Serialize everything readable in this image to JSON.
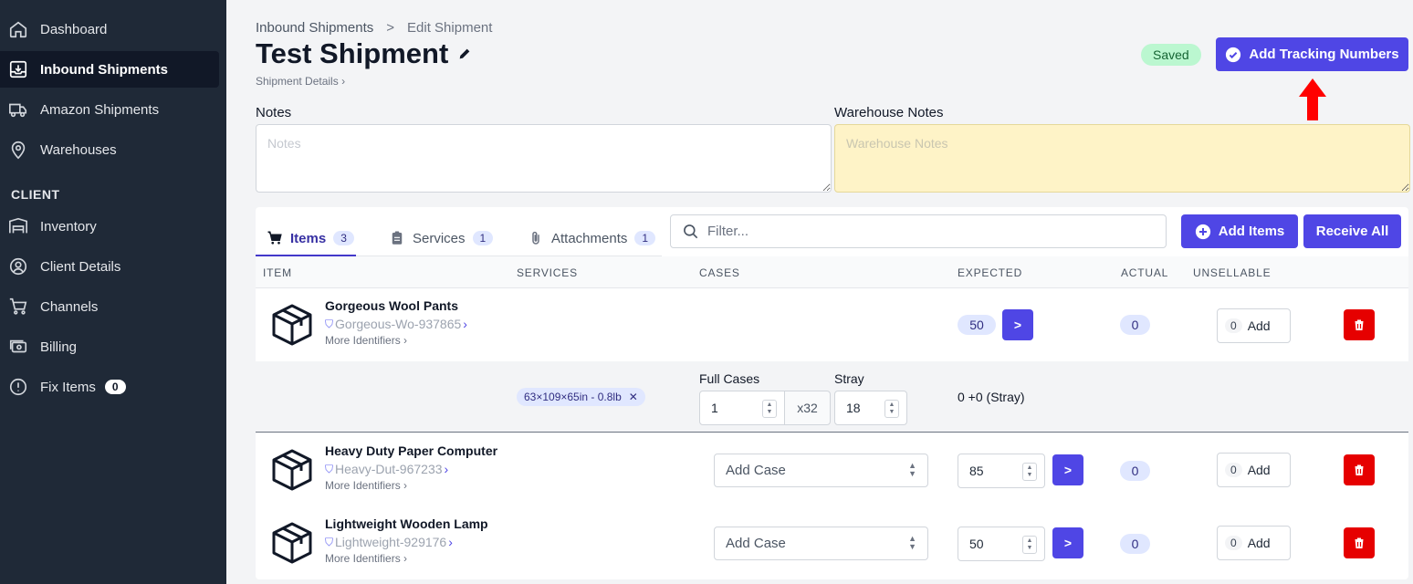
{
  "sidebar": {
    "items": [
      {
        "label": "Dashboard",
        "icon": "home-icon"
      },
      {
        "label": "Inbound Shipments",
        "icon": "inbox-download-icon"
      },
      {
        "label": "Amazon Shipments",
        "icon": "truck-icon"
      },
      {
        "label": "Warehouses",
        "icon": "location-pin-icon"
      }
    ],
    "section_label": "CLIENT",
    "client_items": [
      {
        "label": "Inventory",
        "icon": "shelves-icon"
      },
      {
        "label": "Client Details",
        "icon": "user-circle-icon"
      },
      {
        "label": "Channels",
        "icon": "cart-icon"
      },
      {
        "label": "Billing",
        "icon": "cash-icon"
      },
      {
        "label": "Fix Items",
        "icon": "alert-circle-icon",
        "count": "0"
      }
    ]
  },
  "header": {
    "breadcrumb_root": "Inbound Shipments",
    "breadcrumb_sep": ">",
    "breadcrumb_current": "Edit Shipment",
    "title": "Test Shipment",
    "sub_link": "Shipment Details",
    "saved_badge": "Saved",
    "tracking_button": "Add Tracking Numbers"
  },
  "notes": {
    "label": "Notes",
    "placeholder": "Notes",
    "warehouse_label": "Warehouse Notes",
    "warehouse_placeholder": "Warehouse Notes"
  },
  "tabs": [
    {
      "label": "Items",
      "count": "3",
      "icon": "cart-icon"
    },
    {
      "label": "Services",
      "count": "1",
      "icon": "clipboard-icon"
    },
    {
      "label": "Attachments",
      "count": "1",
      "icon": "paperclip-icon"
    }
  ],
  "filter": {
    "placeholder": "Filter..."
  },
  "actions": {
    "add_items": "Add Items",
    "receive_all": "Receive All"
  },
  "columns": [
    "ITEM",
    "SERVICES",
    "CASES",
    "EXPECTED",
    "ACTUAL",
    "UNSELLABLE"
  ],
  "items": [
    {
      "name": "Gorgeous Wool Pants",
      "sku": "Gorgeous-Wo-937865",
      "more": "More Identifiers",
      "expected": "50",
      "actual": "0",
      "unsellable": "0",
      "add": "Add"
    },
    {
      "name": "Heavy Duty Paper Computer",
      "sku": "Heavy-Dut-967233",
      "more": "More Identifiers",
      "case_placeholder": "Add Case",
      "expected": "85",
      "actual": "0",
      "unsellable": "0",
      "add": "Add"
    },
    {
      "name": "Lightweight Wooden Lamp",
      "sku": "Lightweight-929176",
      "more": "More Identifiers",
      "case_placeholder": "Add Case",
      "expected": "50",
      "actual": "0",
      "unsellable": "0",
      "add": "Add"
    }
  ],
  "case_detail": {
    "dimensions": "63×109×65in - 0.8lb",
    "full_cases_label": "Full Cases",
    "full_cases_value": "1",
    "multiplier": "x32",
    "stray_label": "Stray",
    "stray_value": "18",
    "summary": "0 +0 (Stray)"
  },
  "colors": {
    "sidebar": "#1f2937",
    "accent": "#4f46e5",
    "danger": "#e60000",
    "saved": "#bbf7d0",
    "warehouse_notes": "#fef3c7",
    "arrow": "#ff0000"
  }
}
